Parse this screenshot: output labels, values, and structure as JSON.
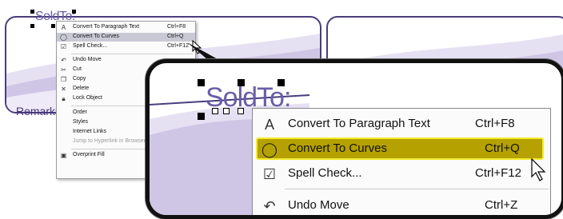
{
  "document": {
    "sold_to_label": "SoldTo:",
    "remarks_label": "Remarks"
  },
  "context_menu": {
    "items": [
      {
        "icon": "paragraph-text-icon",
        "label": "Convert To Paragraph Text",
        "shortcut": "Ctrl+F8"
      },
      {
        "icon": "curves-icon",
        "label": "Convert To Curves",
        "shortcut": "Ctrl+Q"
      },
      {
        "icon": "spell-check-icon",
        "label": "Spell Check...",
        "shortcut": "Ctrl+F12"
      },
      {
        "icon": "undo-icon",
        "label": "Undo Move",
        "shortcut": "Ctrl+Z"
      },
      {
        "icon": "cut-icon",
        "label": "Cut",
        "shortcut": ""
      },
      {
        "icon": "copy-icon",
        "label": "Copy",
        "shortcut": ""
      },
      {
        "icon": "delete-icon",
        "label": "Delete",
        "shortcut": ""
      },
      {
        "icon": "lock-icon",
        "label": "Lock Object",
        "shortcut": ""
      },
      {
        "icon": "",
        "label": "Order",
        "shortcut": ""
      },
      {
        "icon": "",
        "label": "Styles",
        "shortcut": ""
      },
      {
        "icon": "",
        "label": "Internet Links",
        "shortcut": ""
      },
      {
        "icon": "",
        "label": "Jump to Hyperlink in Browser",
        "shortcut": ""
      },
      {
        "icon": "overprint-icon",
        "label": "Overprint Fill",
        "shortcut": ""
      }
    ],
    "highlighted_item": "Convert To Curves"
  },
  "colors": {
    "highlight_zoom": "#b5a100",
    "highlight_border": "#f4ea2c",
    "highlight_small": "#c9c9d6",
    "document_text": "#6a5da8",
    "card_border": "#4a3d7c"
  }
}
